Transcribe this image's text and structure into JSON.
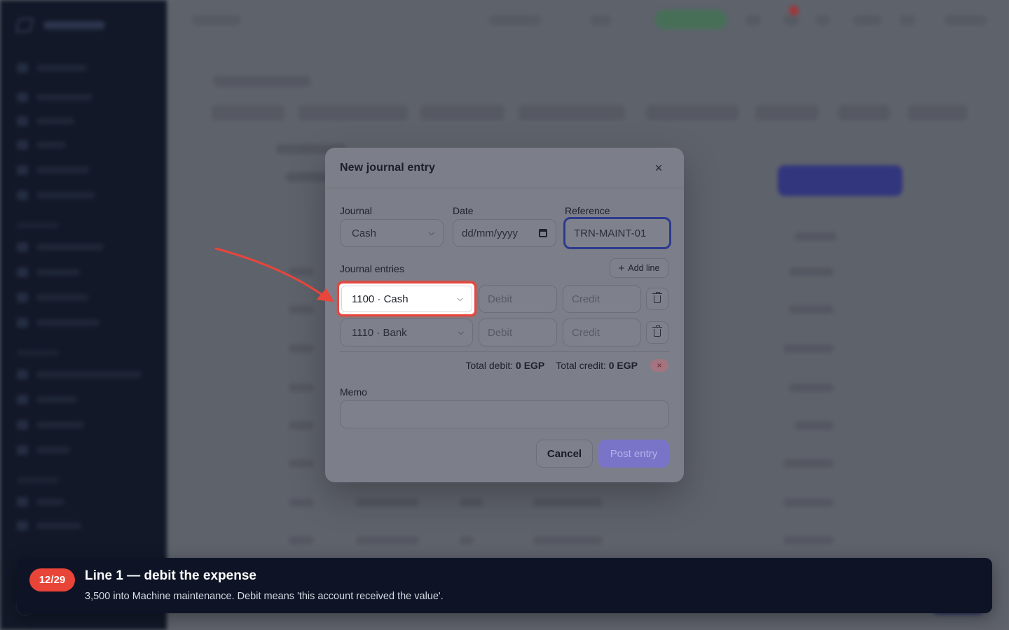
{
  "modal": {
    "title": "New journal entry",
    "close_icon": "×",
    "journal_label": "Journal",
    "journal_value": "Cash",
    "date_label": "Date",
    "date_placeholder": "dd/mm/yyyy",
    "reference_label": "Reference",
    "reference_value": "TRN-MAINT-01",
    "entries_label": "Journal entries",
    "add_line_label": "Add line",
    "lines": [
      {
        "account": "1100 · Cash",
        "debit_placeholder": "Debit",
        "credit_placeholder": "Credit"
      },
      {
        "account": "1110 · Bank",
        "debit_placeholder": "Debit",
        "credit_placeholder": "Credit"
      }
    ],
    "total_debit_label": "Total debit:",
    "total_debit_value": "0 EGP",
    "total_credit_label": "Total credit:",
    "total_credit_value": "0 EGP",
    "balance_status_icon": "×",
    "memo_label": "Memo",
    "cancel_label": "Cancel",
    "post_label": "Post entry"
  },
  "tour": {
    "step": "12/29",
    "title": "Line 1 — debit the expense",
    "body": "3,500 into Machine maintenance. Debit means 'this account received the value'."
  },
  "colors": {
    "highlight": "#e8453c",
    "badge": "#e94438",
    "tour_bg": "#0e1426",
    "primary": "#4a44d0"
  }
}
